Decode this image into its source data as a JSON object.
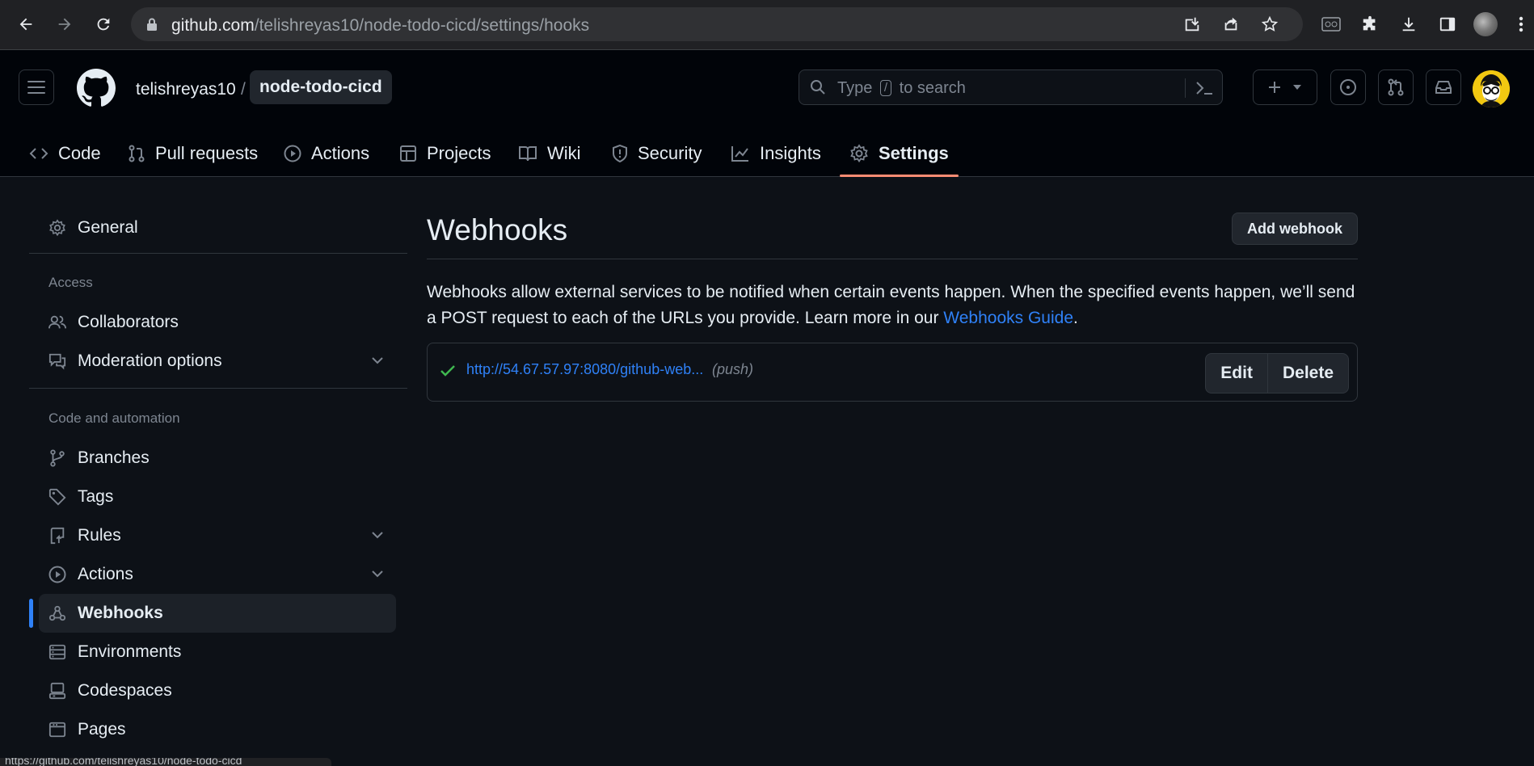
{
  "browser": {
    "url_host": "github.com",
    "url_path": "/telishreyas10/node-todo-cicd/settings/hooks",
    "status_url": "https://github.com/telishreyas10/node-todo-cicd"
  },
  "header": {
    "owner": "telishreyas10",
    "separator": "/",
    "repo": "node-todo-cicd",
    "search_prefix": "Type",
    "search_key": "/",
    "search_suffix": "to search"
  },
  "tabs": [
    {
      "label": "Code",
      "icon": "code-icon"
    },
    {
      "label": "Pull requests",
      "icon": "pull-request-icon"
    },
    {
      "label": "Actions",
      "icon": "play-icon"
    },
    {
      "label": "Projects",
      "icon": "table-icon"
    },
    {
      "label": "Wiki",
      "icon": "book-icon"
    },
    {
      "label": "Security",
      "icon": "shield-icon"
    },
    {
      "label": "Insights",
      "icon": "graph-icon"
    },
    {
      "label": "Settings",
      "icon": "gear-icon",
      "selected": true
    }
  ],
  "sidebar": {
    "general": "General",
    "access_heading": "Access",
    "collaborators": "Collaborators",
    "moderation": "Moderation options",
    "code_heading": "Code and automation",
    "branches": "Branches",
    "tags": "Tags",
    "rules": "Rules",
    "actions": "Actions",
    "webhooks": "Webhooks",
    "environments": "Environments",
    "codespaces": "Codespaces",
    "pages": "Pages"
  },
  "main": {
    "title": "Webhooks",
    "add_button": "Add webhook",
    "description": "Webhooks allow external services to be notified when certain events happen. When the specified events happen, we’ll send a POST request to each of the URLs you provide. Learn more in our ",
    "guide_link": "Webhooks Guide",
    "description_end": ".",
    "hook": {
      "url": "http://54.67.57.97:8080/github-web...",
      "events": "(push)",
      "status": "success",
      "edit_label": "Edit",
      "delete_label": "Delete"
    }
  },
  "colors": {
    "accent": "#2f81f7",
    "tab_underline": "#fd8c73",
    "success": "#3fb950",
    "background": "#0d1117"
  }
}
